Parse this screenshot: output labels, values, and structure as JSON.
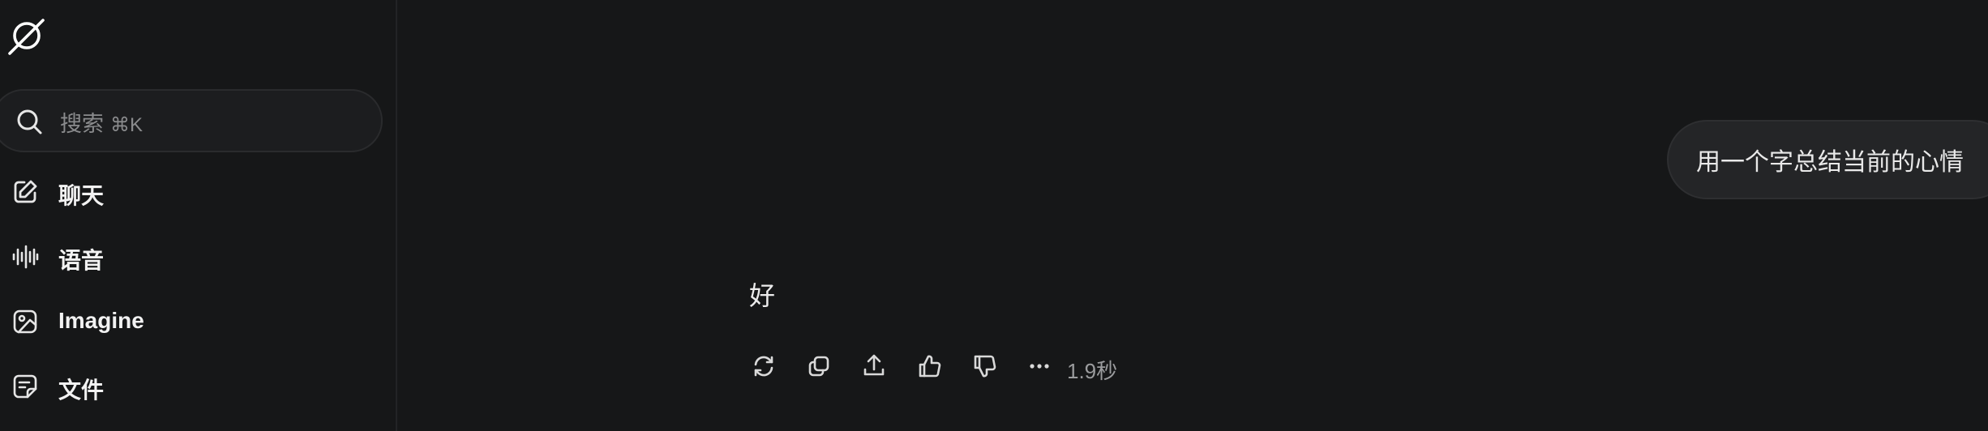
{
  "sidebar": {
    "logo_icon": "grok-logo-icon",
    "search": {
      "label": "搜索",
      "shortcut": "⌘K",
      "icon": "search-icon"
    },
    "items": [
      {
        "label": "聊天",
        "icon": "edit-icon"
      },
      {
        "label": "语音",
        "icon": "waveform-icon"
      },
      {
        "label": "Imagine",
        "icon": "image-icon"
      },
      {
        "label": "文件",
        "icon": "file-icon"
      }
    ]
  },
  "conversation": {
    "user_message": "用一个字总结当前的心情",
    "assistant_reply": "好",
    "response_time": "1.9秒",
    "actions": [
      "regenerate-icon",
      "copy-icon",
      "share-icon",
      "thumbs-up-icon",
      "thumbs-down-icon",
      "more-icon"
    ]
  },
  "colors": {
    "background": "#161718",
    "bubble": "#242527",
    "text": "#e8e8e8",
    "muted": "#9b9c9e"
  }
}
